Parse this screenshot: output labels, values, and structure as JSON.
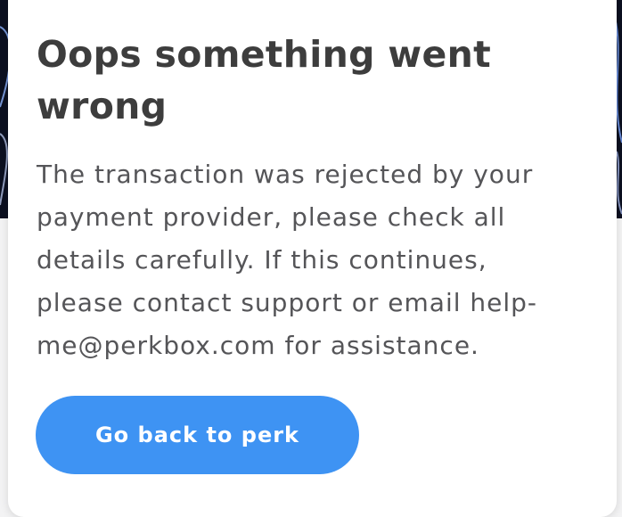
{
  "modal": {
    "title": "Oops something went wrong",
    "message": "The transaction was rejected by your payment provider, please check all details carefully. If this continues, please contact support or email help-me@perkbox.com for assistance.",
    "button_label": "Go back to perk"
  },
  "colors": {
    "button_background": "#3e93f3",
    "title_text": "#3d3d3d",
    "body_text": "#555558",
    "card_background": "#ffffff",
    "backdrop_dark": "#0c1020"
  }
}
